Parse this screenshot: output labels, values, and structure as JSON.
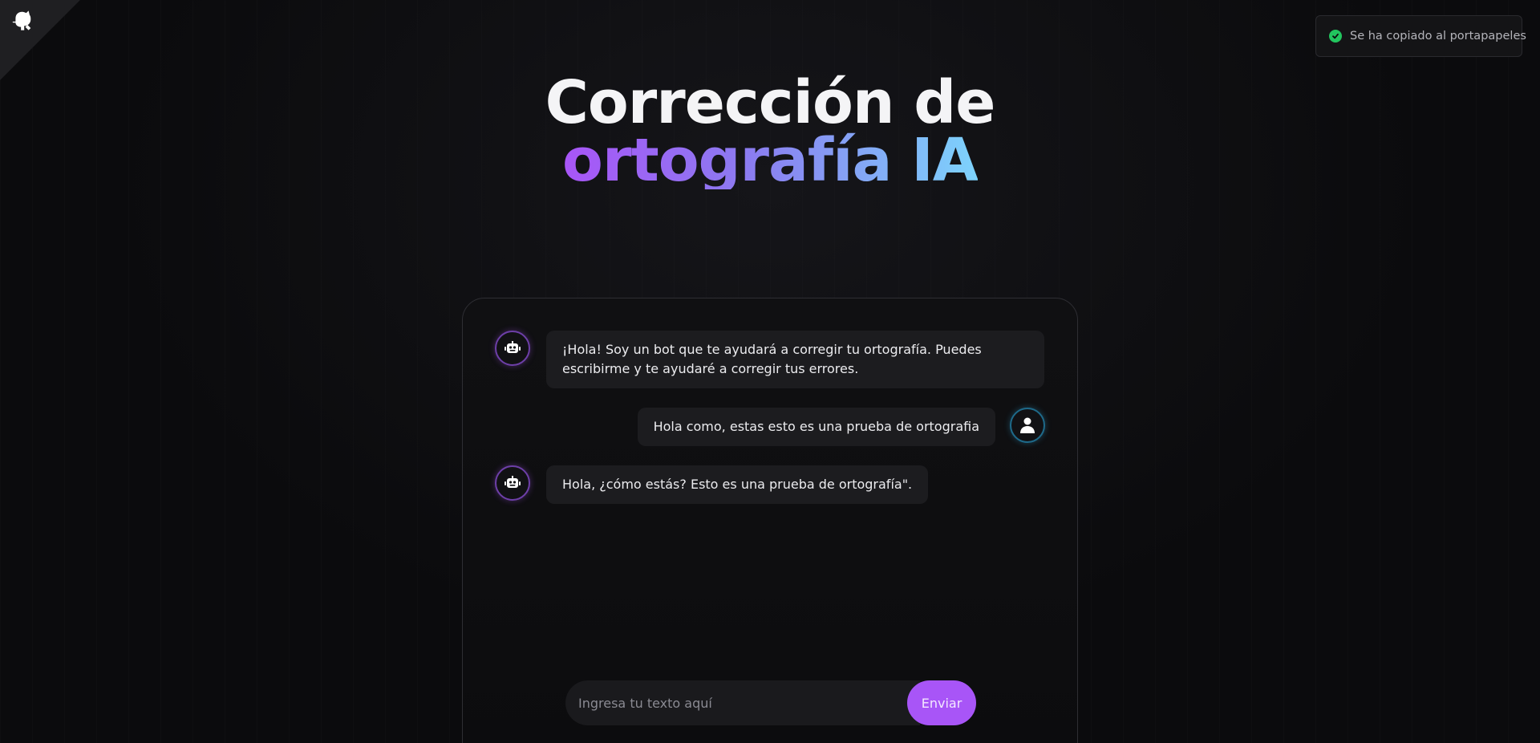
{
  "toast": {
    "message": "Se ha copiado al portapapeles",
    "status_color": "#22c55e"
  },
  "header": {
    "title_line1": "Corrección de",
    "title_line2": "ortografía IA",
    "gradient_colors": [
      "#a855f7",
      "#8b7cf0",
      "#7dd3fc"
    ]
  },
  "corner": {
    "icon": "github-octocat-icon"
  },
  "chat": {
    "messages": [
      {
        "sender": "bot",
        "icon": "robot-icon",
        "text": "¡Hola! Soy un bot que te ayudará a corregir tu ortografía. Puedes escribirme y te ayudaré a corregir tus errores."
      },
      {
        "sender": "user",
        "icon": "user-icon",
        "text": "Hola como, estas esto es una prueba de ortografia"
      },
      {
        "sender": "bot",
        "icon": "robot-icon",
        "text": "Hola, ¿cómo estás? Esto es una prueba de ortografía\"."
      }
    ],
    "input": {
      "placeholder": "Ingresa tu texto aquí",
      "value": ""
    },
    "send_label": "Enviar",
    "accent_color": "#a855f7"
  }
}
